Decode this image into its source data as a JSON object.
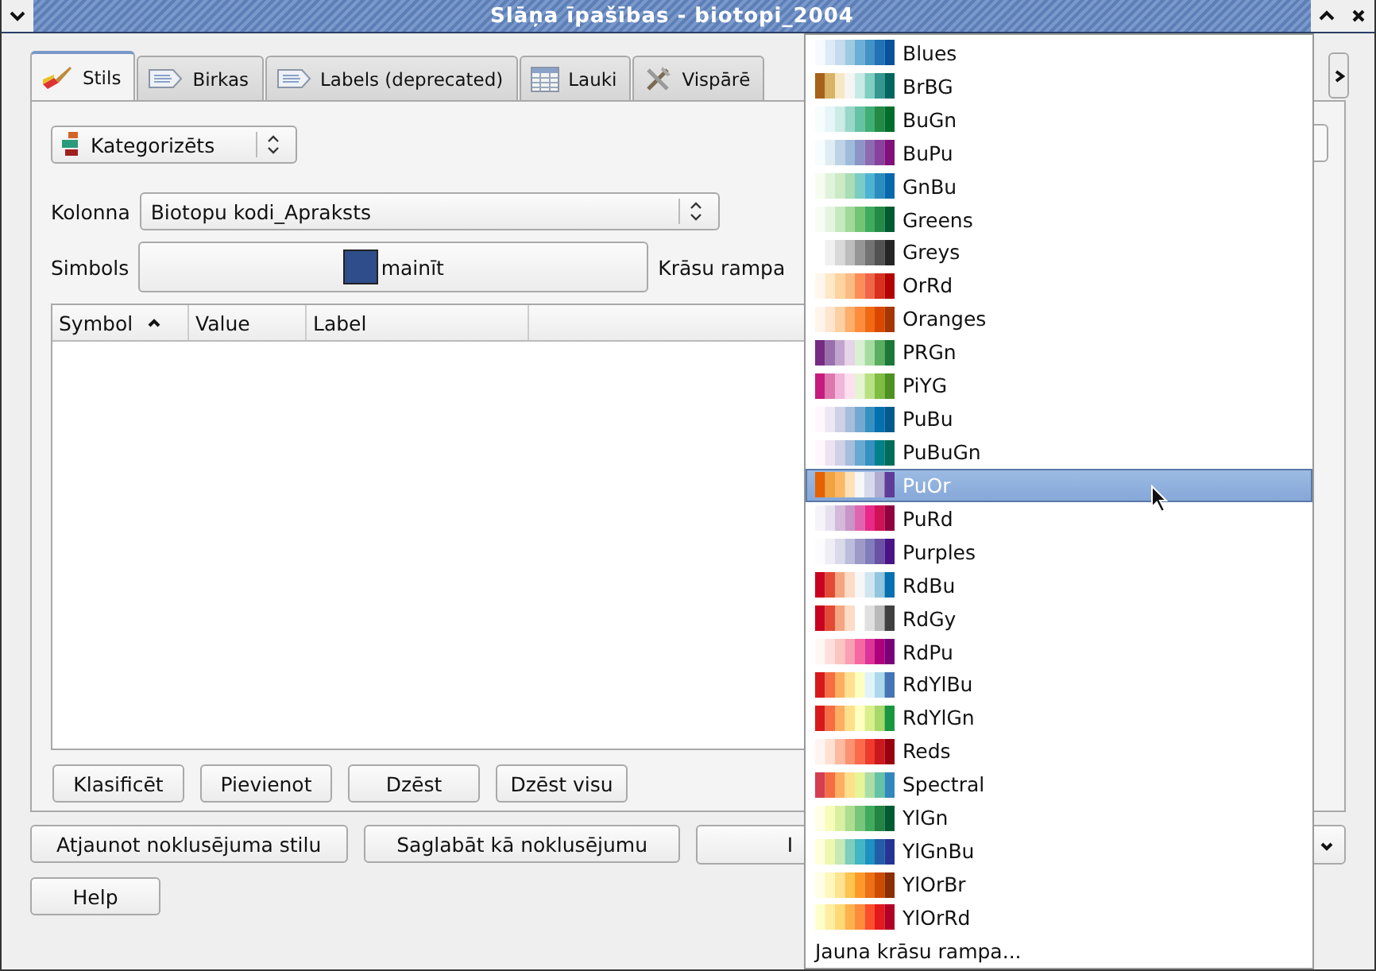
{
  "window": {
    "title": "Slāņa īpašības - biotopi_2004"
  },
  "tabs": [
    {
      "label": "Stils",
      "selected": true,
      "kind": "brush"
    },
    {
      "label": "Birkas",
      "selected": false,
      "kind": "tag"
    },
    {
      "label": "Labels (deprecated)",
      "selected": false,
      "kind": "tag"
    },
    {
      "label": "Lauki",
      "selected": false,
      "kind": "table"
    },
    {
      "label": "Vispārē",
      "selected": false,
      "kind": "tools"
    }
  ],
  "style_panel": {
    "renderer": "Kategorizēts",
    "column_label": "Kolonna",
    "column_value": "Biotopu kodi_Apraksts",
    "symbol_label": "Simbols",
    "symbol_button": "mainīt",
    "color_ramp_label": "Krāsu rampa",
    "table": {
      "columns": [
        {
          "label": "Symbol",
          "sorted": true
        },
        {
          "label": "Value",
          "sorted": false
        },
        {
          "label": "Label",
          "sorted": false
        }
      ]
    },
    "buttons": [
      "Klasificēt",
      "Pievienot",
      "Dzēst",
      "Dzēst visu"
    ]
  },
  "footer_buttons": [
    "Atjaunot noklusējuma stilu",
    "Saglabāt kā noklusējumu",
    "I"
  ],
  "help_button": "Help",
  "ramp_menu": [
    {
      "label": "Blues",
      "selected": false,
      "kind": "ramp"
    },
    {
      "label": "BrBG",
      "selected": false,
      "kind": "ramp"
    },
    {
      "label": "BuGn",
      "selected": false,
      "kind": "ramp"
    },
    {
      "label": "BuPu",
      "selected": false,
      "kind": "ramp"
    },
    {
      "label": "GnBu",
      "selected": false,
      "kind": "ramp"
    },
    {
      "label": "Greens",
      "selected": false,
      "kind": "ramp"
    },
    {
      "label": "Greys",
      "selected": false,
      "kind": "ramp"
    },
    {
      "label": "OrRd",
      "selected": false,
      "kind": "ramp"
    },
    {
      "label": "Oranges",
      "selected": false,
      "kind": "ramp"
    },
    {
      "label": "PRGn",
      "selected": false,
      "kind": "ramp"
    },
    {
      "label": "PiYG",
      "selected": false,
      "kind": "ramp"
    },
    {
      "label": "PuBu",
      "selected": false,
      "kind": "ramp"
    },
    {
      "label": "PuBuGn",
      "selected": false,
      "kind": "ramp"
    },
    {
      "label": "PuOr",
      "selected": true,
      "kind": "ramp"
    },
    {
      "label": "PuRd",
      "selected": false,
      "kind": "ramp"
    },
    {
      "label": "Purples",
      "selected": false,
      "kind": "ramp"
    },
    {
      "label": "RdBu",
      "selected": false,
      "kind": "ramp"
    },
    {
      "label": "RdGy",
      "selected": false,
      "kind": "ramp"
    },
    {
      "label": "RdPu",
      "selected": false,
      "kind": "ramp"
    },
    {
      "label": "RdYlBu",
      "selected": false,
      "kind": "ramp"
    },
    {
      "label": "RdYlGn",
      "selected": false,
      "kind": "ramp"
    },
    {
      "label": "Reds",
      "selected": false,
      "kind": "ramp"
    },
    {
      "label": "Spectral",
      "selected": false,
      "kind": "ramp"
    },
    {
      "label": "YlGn",
      "selected": false,
      "kind": "ramp"
    },
    {
      "label": "YlGnBu",
      "selected": false,
      "kind": "ramp"
    },
    {
      "label": "YlOrBr",
      "selected": false,
      "kind": "ramp"
    },
    {
      "label": "YlOrRd",
      "selected": false,
      "kind": "ramp"
    },
    {
      "label": "Jauna krāsu rampa...",
      "selected": false,
      "kind": "action"
    }
  ]
}
